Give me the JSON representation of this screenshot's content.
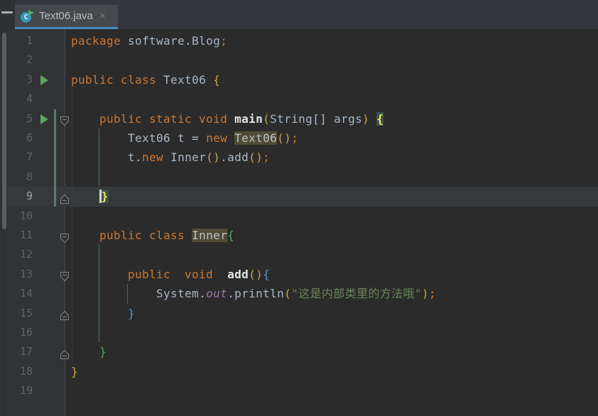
{
  "tab_bar": {
    "tab_title": "Text06.java",
    "close_glyph": "×",
    "java_icon_letter": "C"
  },
  "colors": {
    "accent_tab_underline": "#4A88C5",
    "editor_background": "#2B2B2B",
    "gutter_background": "#313335",
    "keyword_orange": "#CC7832",
    "plain_text": "#A9B7C6",
    "string_green": "#6A8759",
    "field_purple": "#9876AA",
    "brace_gold": "#CBA93F",
    "brace_green": "#55A25F",
    "brace_blue": "#5693CE",
    "matched_brace_bg": "#3B514D",
    "identifier_highlight_bg": "#4F4B35",
    "run_arrow_green": "#5CA65C",
    "vcs_change_bar": "#567E6B"
  },
  "editor": {
    "current_line": 9,
    "lines": [
      {
        "n": "1",
        "run": false,
        "fold": null,
        "tokens": [
          {
            "t": "package",
            "c": "kw"
          },
          {
            "t": " software.Blog",
            "c": "pl"
          },
          {
            "t": ";",
            "c": "semi"
          }
        ]
      },
      {
        "n": "2",
        "run": false,
        "fold": null,
        "tokens": []
      },
      {
        "n": "3",
        "run": true,
        "fold": null,
        "tokens": [
          {
            "t": "public class",
            "c": "kw"
          },
          {
            "t": " Text06 ",
            "c": "pl"
          },
          {
            "t": "{",
            "c": "b1"
          }
        ]
      },
      {
        "n": "4",
        "run": false,
        "fold": null,
        "tokens": []
      },
      {
        "n": "5",
        "run": true,
        "fold": "down",
        "tokens": [
          {
            "t": "    ",
            "c": "pl"
          },
          {
            "t": "public static void ",
            "c": "kw"
          },
          {
            "t": "main",
            "c": "decl"
          },
          {
            "t": "(",
            "c": "p1"
          },
          {
            "t": "String[] args",
            "c": "pl"
          },
          {
            "t": ")",
            "c": "p1"
          },
          {
            "t": " ",
            "c": "pl"
          },
          {
            "t": "{",
            "c": "bhl"
          }
        ]
      },
      {
        "n": "6",
        "run": false,
        "fold": null,
        "tokens": [
          {
            "t": "        ",
            "c": "pl"
          },
          {
            "t": "Text06 t = ",
            "c": "pl"
          },
          {
            "t": "new",
            "c": "kw"
          },
          {
            "t": " ",
            "c": "pl"
          },
          {
            "t": "Text06",
            "c": "olive"
          },
          {
            "t": "()",
            "c": "p1"
          },
          {
            "t": ";",
            "c": "semi"
          }
        ]
      },
      {
        "n": "7",
        "run": false,
        "fold": null,
        "tokens": [
          {
            "t": "        ",
            "c": "pl"
          },
          {
            "t": "t.",
            "c": "pl"
          },
          {
            "t": "new",
            "c": "kw"
          },
          {
            "t": " Inner",
            "c": "pl"
          },
          {
            "t": "()",
            "c": "p1"
          },
          {
            "t": ".add",
            "c": "pl"
          },
          {
            "t": "()",
            "c": "p1"
          },
          {
            "t": ";",
            "c": "semi"
          }
        ]
      },
      {
        "n": "8",
        "run": false,
        "fold": null,
        "tokens": []
      },
      {
        "n": "9",
        "run": false,
        "fold": "up",
        "tokens": [
          {
            "t": "    ",
            "c": "pl"
          },
          {
            "caret": true
          },
          {
            "t": "}",
            "c": "bhl"
          }
        ]
      },
      {
        "n": "10",
        "run": false,
        "fold": null,
        "tokens": []
      },
      {
        "n": "11",
        "run": false,
        "fold": "down",
        "tokens": [
          {
            "t": "    ",
            "c": "pl"
          },
          {
            "t": "public class ",
            "c": "kw"
          },
          {
            "t": "Inner",
            "c": "olive"
          },
          {
            "t": "{",
            "c": "b2"
          }
        ]
      },
      {
        "n": "12",
        "run": false,
        "fold": null,
        "tokens": []
      },
      {
        "n": "13",
        "run": false,
        "fold": "down",
        "tokens": [
          {
            "t": "        ",
            "c": "pl"
          },
          {
            "t": "public  void  ",
            "c": "kw"
          },
          {
            "t": "add",
            "c": "decl"
          },
          {
            "t": "()",
            "c": "p1"
          },
          {
            "t": "{",
            "c": "b3"
          }
        ]
      },
      {
        "n": "14",
        "run": false,
        "fold": null,
        "tokens": [
          {
            "t": "            ",
            "c": "pl"
          },
          {
            "t": "System.",
            "c": "pl"
          },
          {
            "t": "out",
            "c": "field"
          },
          {
            "t": ".println",
            "c": "pl"
          },
          {
            "t": "(",
            "c": "p1"
          },
          {
            "t": "\"这是内部类里的方法哦\"",
            "c": "str"
          },
          {
            "t": ")",
            "c": "p1"
          },
          {
            "t": ";",
            "c": "semi"
          }
        ]
      },
      {
        "n": "15",
        "run": false,
        "fold": "up",
        "tokens": [
          {
            "t": "        ",
            "c": "pl"
          },
          {
            "t": "}",
            "c": "b3"
          }
        ]
      },
      {
        "n": "16",
        "run": false,
        "fold": null,
        "tokens": []
      },
      {
        "n": "17",
        "run": false,
        "fold": "up",
        "tokens": [
          {
            "t": "    ",
            "c": "pl"
          },
          {
            "t": "}",
            "c": "b2"
          }
        ]
      },
      {
        "n": "18",
        "run": false,
        "fold": null,
        "tokens": [
          {
            "t": "}",
            "c": "b1"
          }
        ]
      },
      {
        "n": "19",
        "run": false,
        "fold": null,
        "tokens": []
      }
    ]
  }
}
